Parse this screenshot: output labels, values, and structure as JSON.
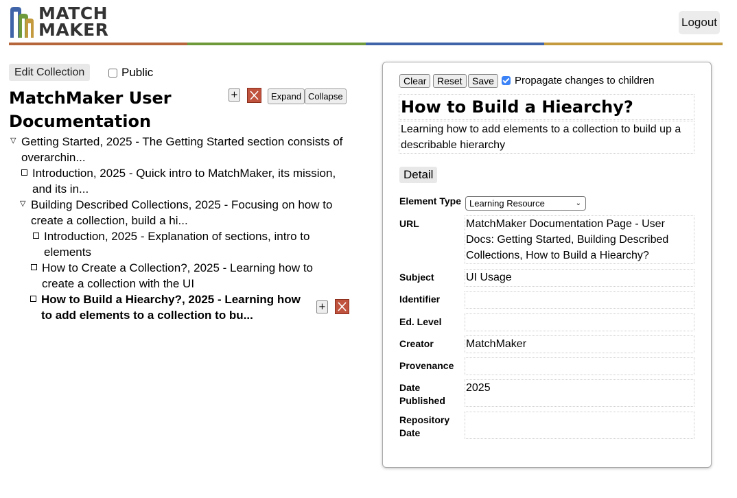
{
  "header": {
    "logo_line1": "MATCH",
    "logo_line2": "MAKER",
    "logout_label": "Logout",
    "rainbow_colors": [
      "#b5663a",
      "#6f9a3c",
      "#3f64a8",
      "#c49a3e"
    ]
  },
  "left": {
    "edit_collection_label": "Edit Collection",
    "public_label": "Public",
    "collection_title": "MatchMaker User Documentation",
    "add_label": "+",
    "expand_label": "Expand",
    "collapse_label": "Collapse",
    "tree": [
      {
        "text": "Getting Started, 2025 - The Getting Started section consists of overarchin...",
        "marker": "▽"
      },
      {
        "text": "Introduction, 2025 - Quick intro to MatchMaker, its mission, and its in...",
        "marker": "box"
      },
      {
        "text": "Building Described Collections, 2025 - Focusing on how to create a collection, build a hi...",
        "marker": "▽"
      },
      {
        "text": "Introduction, 2025 - Explanation of sections, intro to elements",
        "marker": "box"
      },
      {
        "text": "How to Create a Collection?, 2025 - Learning how to create a collection with the UI",
        "marker": "box"
      },
      {
        "text": "How to Build a Hiearchy?, 2025 - Learning how to add elements to a collection to bu...",
        "marker": "box"
      }
    ]
  },
  "right": {
    "clear_label": "Clear",
    "reset_label": "Reset",
    "save_label": "Save",
    "propagate_label": "Propagate changes to children",
    "title": "How to Build a Hiearchy?",
    "description": "Learning how to add elements to a collection to build up a describable hierarchy",
    "detail_label": "Detail",
    "fields": {
      "element_type": {
        "label": "Element Type",
        "value": "Learning Resource"
      },
      "url": {
        "label": "URL",
        "value": "MatchMaker Documentation Page - User Docs: Getting Started, Building Described Collections, How to Build a Hiearchy?"
      },
      "subject": {
        "label": "Subject",
        "value": "UI Usage"
      },
      "identifier": {
        "label": "Identifier",
        "value": ""
      },
      "ed_level": {
        "label": "Ed. Level",
        "value": ""
      },
      "creator": {
        "label": "Creator",
        "value": "MatchMaker"
      },
      "provenance": {
        "label": "Provenance",
        "value": ""
      },
      "date_published": {
        "label": "Date Published",
        "value": "2025"
      },
      "repository_date": {
        "label": "Repository Date",
        "value": ""
      }
    }
  }
}
